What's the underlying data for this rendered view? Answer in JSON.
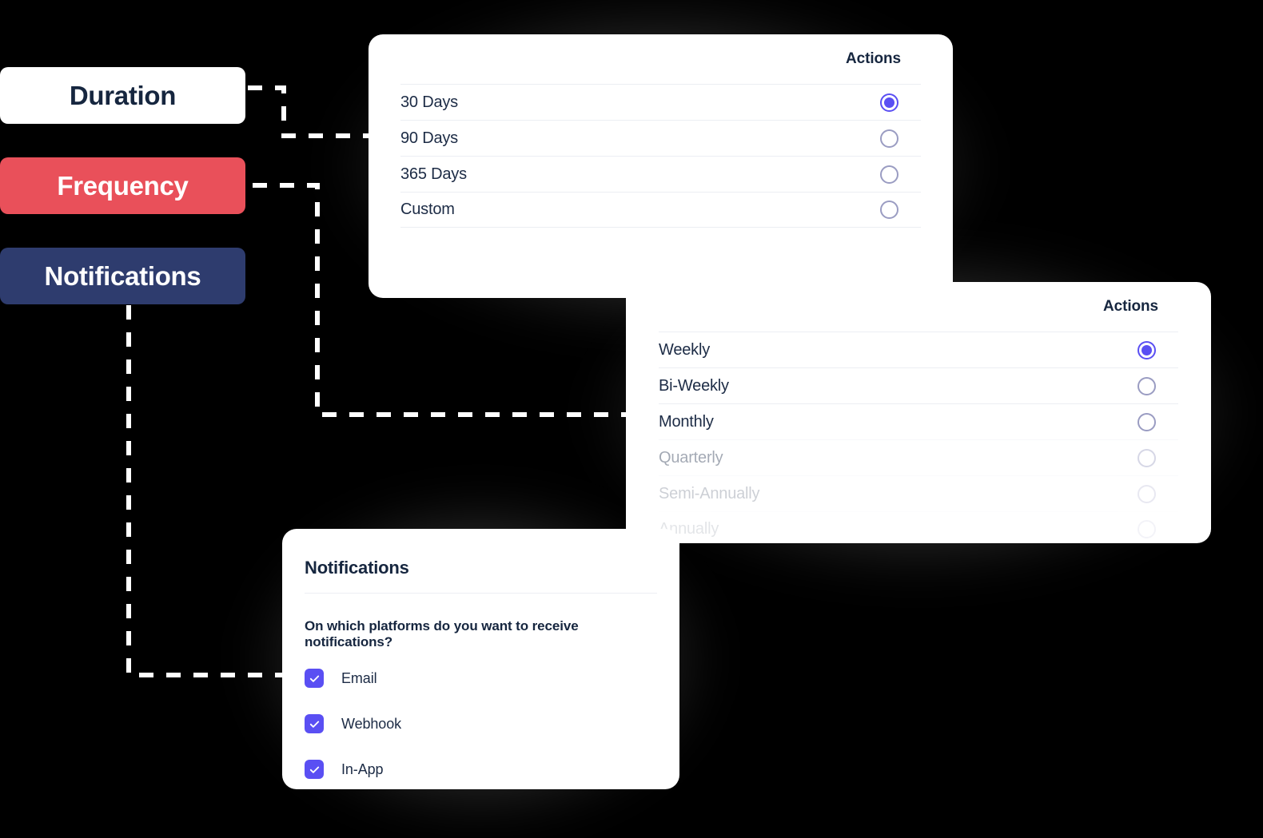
{
  "labels": [
    {
      "text": "Duration",
      "color": "#ffffff",
      "text_color": "#16263f"
    },
    {
      "text": "Frequency",
      "color": "#e9505a",
      "text_color": "#ffffff"
    },
    {
      "text": "Notifications",
      "color": "#2e3c6e",
      "text_color": "#ffffff"
    }
  ],
  "duration_card": {
    "actions_header": "Actions",
    "options": [
      {
        "label": "30 Days",
        "selected": true
      },
      {
        "label": "90 Days",
        "selected": false
      },
      {
        "label": "365 Days",
        "selected": false
      },
      {
        "label": "Custom",
        "selected": false
      }
    ]
  },
  "frequency_card": {
    "actions_header": "Actions",
    "options": [
      {
        "label": "Weekly",
        "selected": true
      },
      {
        "label": "Bi-Weekly",
        "selected": false
      },
      {
        "label": "Monthly",
        "selected": false
      },
      {
        "label": "Quarterly",
        "selected": false
      },
      {
        "label": "Semi-Annually",
        "selected": false
      },
      {
        "label": "Annually",
        "selected": false
      }
    ]
  },
  "notifications_card": {
    "title": "Notifications",
    "question": "On which platforms do you want to receive notifications?",
    "platforms": [
      {
        "label": "Email",
        "checked": true
      },
      {
        "label": "Webhook",
        "checked": true
      },
      {
        "label": "In-App",
        "checked": true
      }
    ]
  },
  "colors": {
    "accent": "#5a4ff3",
    "navy": "#2e3c6e",
    "red": "#e9505a",
    "text_dark": "#16263f",
    "background": "#000000",
    "connector": "#ffffff"
  }
}
